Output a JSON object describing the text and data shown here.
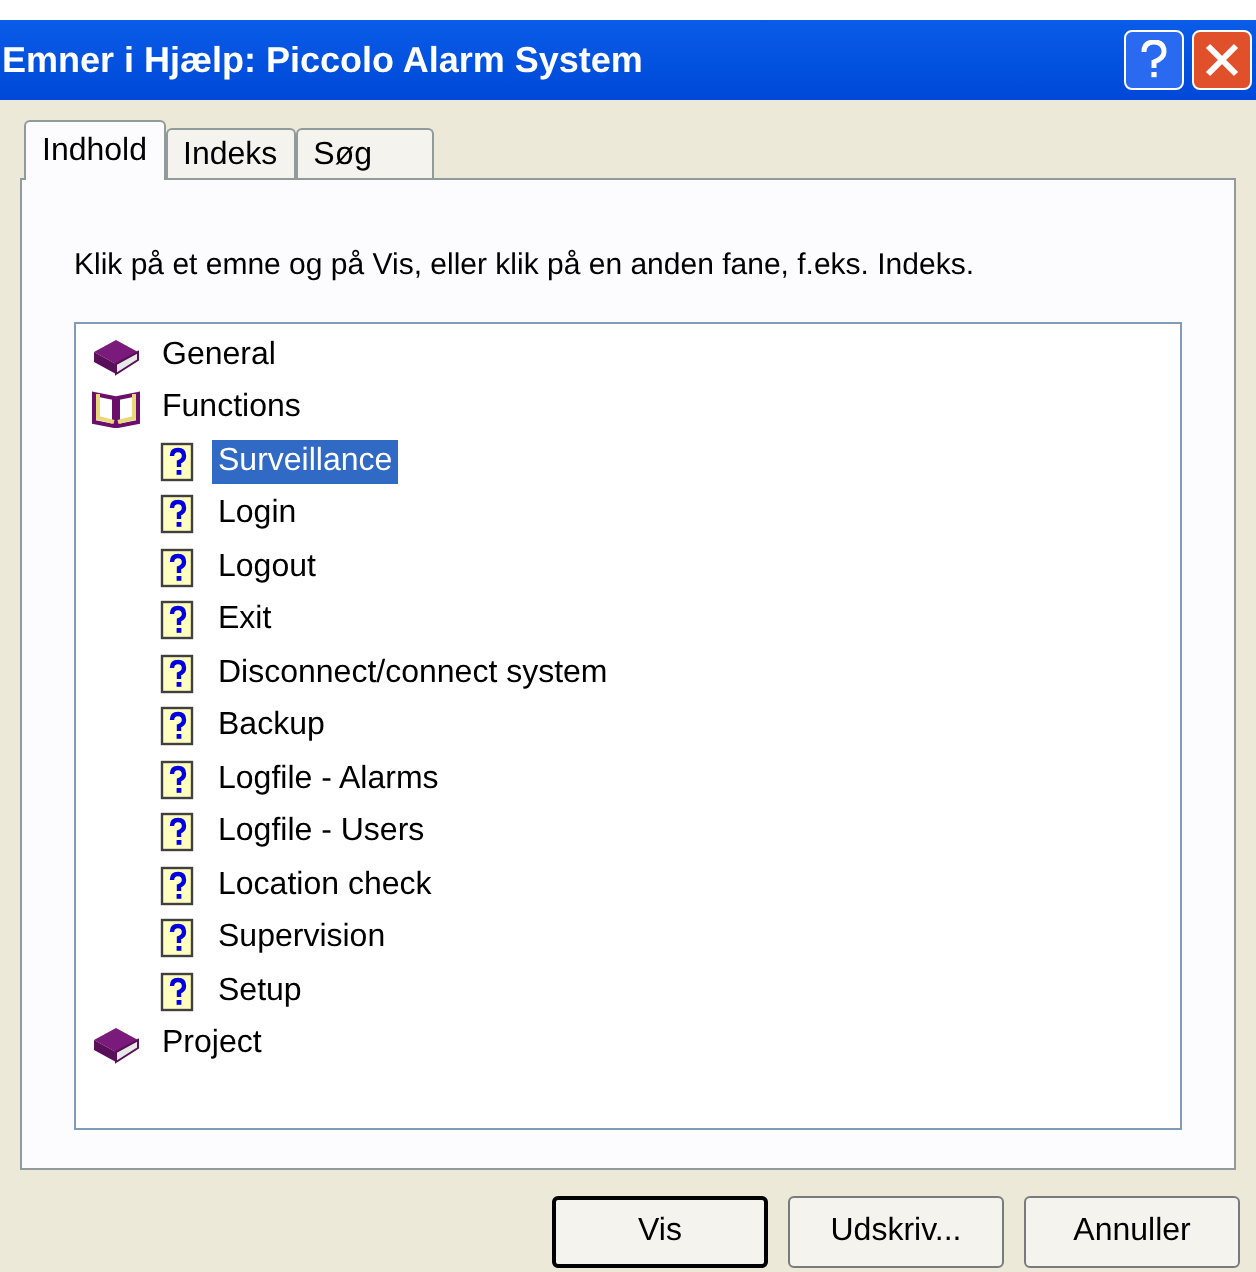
{
  "window": {
    "title": "Emner i Hjælp: Piccolo Alarm System"
  },
  "tabs": [
    {
      "label": "Indhold",
      "selected": true
    },
    {
      "label": "Indeks",
      "selected": false
    },
    {
      "label": "Søg",
      "selected": false
    }
  ],
  "instruction": "Klik på et emne og på Vis, eller klik på en anden fane, f.eks. Indeks.",
  "tree": [
    {
      "label": "General",
      "kind": "book",
      "expanded": false,
      "selected": false
    },
    {
      "label": "Functions",
      "kind": "book",
      "expanded": true,
      "selected": false,
      "children": [
        {
          "label": "Surveillance",
          "kind": "page",
          "selected": true
        },
        {
          "label": "Login",
          "kind": "page",
          "selected": false
        },
        {
          "label": "Logout",
          "kind": "page",
          "selected": false
        },
        {
          "label": "Exit",
          "kind": "page",
          "selected": false
        },
        {
          "label": "Disconnect/connect system",
          "kind": "page",
          "selected": false
        },
        {
          "label": "Backup",
          "kind": "page",
          "selected": false
        },
        {
          "label": "Logfile - Alarms",
          "kind": "page",
          "selected": false
        },
        {
          "label": "Logfile - Users",
          "kind": "page",
          "selected": false
        },
        {
          "label": "Location check",
          "kind": "page",
          "selected": false
        },
        {
          "label": "Supervision",
          "kind": "page",
          "selected": false
        },
        {
          "label": "Setup",
          "kind": "page",
          "selected": false
        }
      ]
    },
    {
      "label": "Project",
      "kind": "book",
      "expanded": false,
      "selected": false
    }
  ],
  "buttons": [
    {
      "label": "Vis",
      "default": true
    },
    {
      "label": "Udskriv...",
      "default": false
    },
    {
      "label": "Annuller",
      "default": false
    }
  ]
}
